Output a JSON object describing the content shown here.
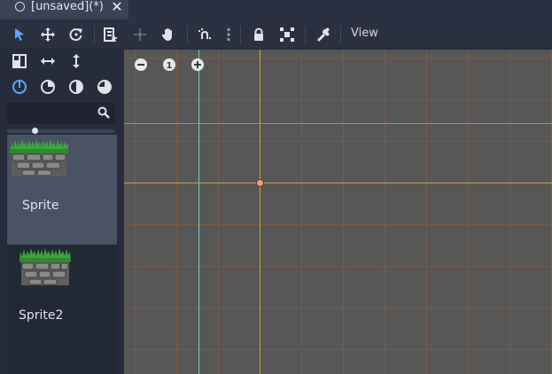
{
  "tab": {
    "title": "[unsaved](*)",
    "close": "✕"
  },
  "toolbar": {
    "icons": [
      "select-icon",
      "move-icon",
      "rotate-icon",
      "list-icon",
      "pivot-icon",
      "pan-icon",
      "snap-icon",
      "more-icon",
      "lock-icon",
      "group-icon",
      "bone-icon"
    ],
    "view_menu": "View"
  },
  "left_panel": {
    "search": {
      "placeholder": "",
      "value": ""
    },
    "thumbnail_size": 0.25,
    "items": [
      {
        "label": "Sprite",
        "selected": true
      },
      {
        "label": "Sprite2",
        "selected": false
      }
    ]
  },
  "viewport": {
    "zoom_reset_label": "1"
  },
  "colors": {
    "background": "#202531",
    "toolbar": "#2c3141",
    "panel": "#262c3b",
    "selected_item": "#4a5366",
    "viewport": "#575757",
    "accent": "#5fa5ff",
    "grid_line": "#7a5a46",
    "axis_x": "#c9a24a",
    "axis_y": "#6fd4c8",
    "guide": "#c86ad1",
    "origin": "#f0a078"
  }
}
